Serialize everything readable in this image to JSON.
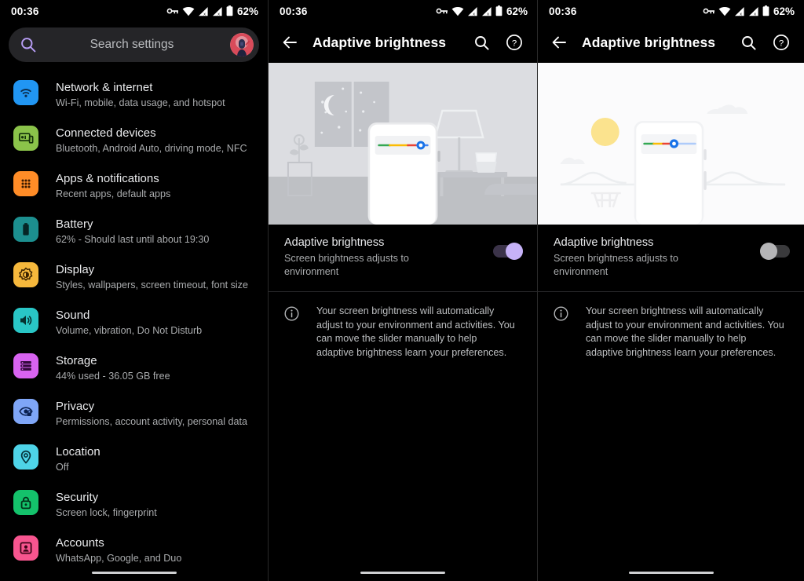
{
  "statusbar": {
    "time": "00:36",
    "battery_percent": "62%",
    "icons": [
      "vpn-key-icon",
      "wifi-icon",
      "signal-no-sim-icon",
      "signal-no-sim-icon-2",
      "battery-icon"
    ]
  },
  "colors": {
    "accent_purple": "#c6b2f7",
    "search_purple": "#b79df5",
    "network_blue": "#2196f3",
    "connected_green": "#8bc34a",
    "apps_orange": "#ff8c27",
    "battery_teal": "#1c8f8f",
    "display_amber": "#f6b83c",
    "sound_cyan": "#29c6c6",
    "storage_magenta": "#d863f0",
    "privacy_blue": "#7fa6f7",
    "location_cyan": "#4ed4e8",
    "security_green": "#14c26b",
    "accounts_pink": "#f7558f",
    "toggle_on_track": "#3b3349",
    "toggle_off_knob": "#b5b5b7",
    "slider_green": "#34a853",
    "slider_yellow": "#fbbc04",
    "slider_red": "#ea4335",
    "slider_thumb_blue": "#1a73e8",
    "sun_yellow": "#fbe38e"
  },
  "search": {
    "placeholder": "Search settings",
    "icon": "search-icon",
    "avatar": "user-avatar"
  },
  "settings_items": [
    {
      "title": "Network & internet",
      "subtitle": "Wi-Fi, mobile, data usage, and hotspot",
      "icon": "wifi-icon",
      "color": "#2196f3"
    },
    {
      "title": "Connected devices",
      "subtitle": "Bluetooth, Android Auto, driving mode, NFC",
      "icon": "cast-devices-icon",
      "color": "#8bc34a"
    },
    {
      "title": "Apps & notifications",
      "subtitle": "Recent apps, default apps",
      "icon": "apps-grid-icon",
      "color": "#ff8c27"
    },
    {
      "title": "Battery",
      "subtitle": "62% - Should last until about 19:30",
      "icon": "battery-icon",
      "color": "#1c8f8f"
    },
    {
      "title": "Display",
      "subtitle": "Styles, wallpapers, screen timeout, font size",
      "icon": "brightness-icon",
      "color": "#f6b83c"
    },
    {
      "title": "Sound",
      "subtitle": "Volume, vibration, Do Not Disturb",
      "icon": "speaker-icon",
      "color": "#29c6c6"
    },
    {
      "title": "Storage",
      "subtitle": "44% used - 36.05 GB free",
      "icon": "storage-list-icon",
      "color": "#d863f0"
    },
    {
      "title": "Privacy",
      "subtitle": "Permissions, account activity, personal data",
      "icon": "eye-lock-icon",
      "color": "#7fa6f7"
    },
    {
      "title": "Location",
      "subtitle": "Off",
      "icon": "location-pin-icon",
      "color": "#4ed4e8"
    },
    {
      "title": "Security",
      "subtitle": "Screen lock, fingerprint",
      "icon": "lock-icon",
      "color": "#14c26b"
    },
    {
      "title": "Accounts",
      "subtitle": "WhatsApp, Google, and Duo",
      "icon": "account-box-icon",
      "color": "#f7558f"
    }
  ],
  "detail": {
    "appbar": {
      "back_icon": "back-arrow-icon",
      "title": "Adaptive brightness",
      "search_icon": "search-icon",
      "help_icon": "help-circle-icon"
    },
    "toggle_row": {
      "title": "Adaptive brightness",
      "subtitle": "Screen brightness adjusts to environment"
    },
    "info": {
      "icon": "info-circle-icon",
      "text": "Your screen brightness will automatically adjust to your environment and activities. You can move the slider manually to help adaptive brightness learn your preferences."
    }
  },
  "panels": {
    "middle": {
      "illustration": "night-bedroom-scene",
      "toggle_state": "on",
      "toggle_state_label": "On"
    },
    "right": {
      "illustration": "day-outdoor-scene",
      "toggle_state": "off",
      "toggle_state_label": "Off"
    }
  },
  "navigation": {
    "pill": "gesture-nav-pill"
  }
}
